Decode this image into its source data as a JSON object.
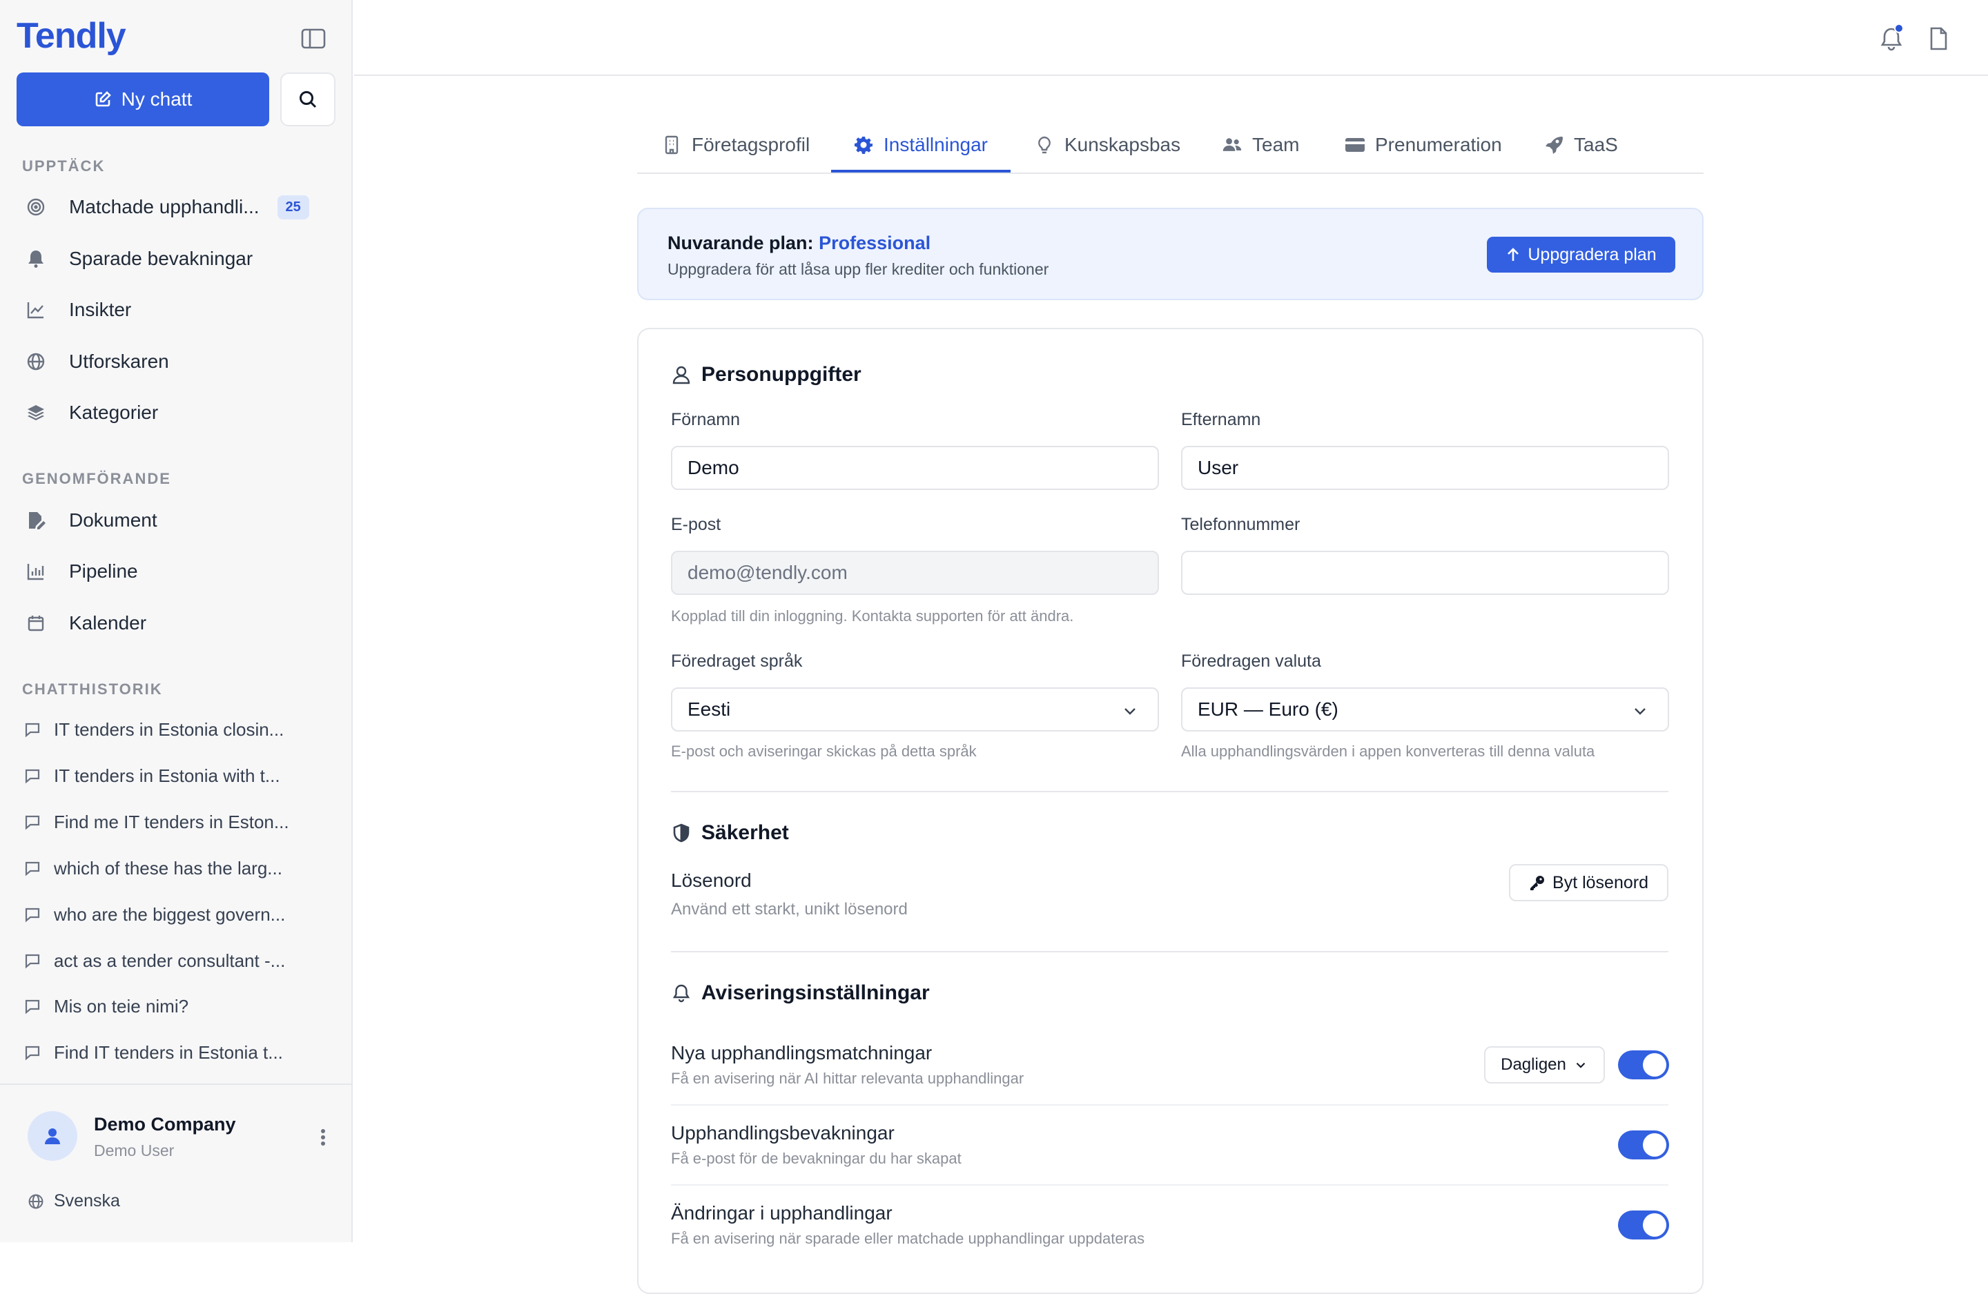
{
  "sidebar": {
    "brand": "Tendly",
    "new_chat_label": "Ny chatt",
    "sections": {
      "discover": "UPPTÄCK",
      "execution": "GENOMFÖRANDE",
      "history": "CHATTHISTORIK"
    },
    "discover_items": [
      {
        "label": "Matchade upphandli...",
        "icon": "target-icon",
        "badge": "25"
      },
      {
        "label": "Sparade bevakningar",
        "icon": "bell-icon"
      },
      {
        "label": "Insikter",
        "icon": "line-chart-icon"
      },
      {
        "label": "Utforskaren",
        "icon": "globe-icon"
      },
      {
        "label": "Kategorier",
        "icon": "layers-icon"
      }
    ],
    "execution_items": [
      {
        "label": "Dokument",
        "icon": "file-edit-icon"
      },
      {
        "label": "Pipeline",
        "icon": "bar-chart-icon"
      },
      {
        "label": "Kalender",
        "icon": "calendar-icon"
      }
    ],
    "chat_history": [
      "IT tenders in Estonia closin...",
      "IT tenders in Estonia with t...",
      "Find me IT tenders in Eston...",
      "which of these has the larg...",
      "who are the biggest govern...",
      "act as a tender consultant -...",
      "Mis on teie nimi?",
      "Find IT tenders in Estonia t..."
    ],
    "user": {
      "company": "Demo Company",
      "name": "Demo User"
    },
    "language": "Svenska"
  },
  "tabs": [
    {
      "label": "Företagsprofil",
      "icon": "building-icon",
      "active": false
    },
    {
      "label": "Inställningar",
      "icon": "gear-icon",
      "active": true
    },
    {
      "label": "Kunskapsbas",
      "icon": "lightbulb-icon",
      "active": false
    },
    {
      "label": "Team",
      "icon": "users-icon",
      "active": false
    },
    {
      "label": "Prenumeration",
      "icon": "credit-card-icon",
      "active": false
    },
    {
      "label": "TaaS",
      "icon": "rocket-icon",
      "active": false
    }
  ],
  "plan": {
    "prefix": "Nuvarande plan:",
    "name": "Professional",
    "subtitle": "Uppgradera för att låsa upp fler krediter och funktioner",
    "upgrade_label": "Uppgradera plan"
  },
  "personal": {
    "heading": "Personuppgifter",
    "first_name_label": "Förnamn",
    "first_name_value": "Demo",
    "last_name_label": "Efternamn",
    "last_name_value": "User",
    "email_label": "E-post",
    "email_placeholder": "demo@tendly.com",
    "email_hint": "Kopplad till din inloggning. Kontakta supporten för att ändra.",
    "phone_label": "Telefonnummer",
    "phone_value": "",
    "language_label": "Föredraget språk",
    "language_value": "Eesti",
    "language_hint": "E-post och aviseringar skickas på detta språk",
    "currency_label": "Föredragen valuta",
    "currency_value": "EUR — Euro (€)",
    "currency_hint": "Alla upphandlingsvärden i appen konverteras till denna valuta"
  },
  "security": {
    "heading": "Säkerhet",
    "password_label": "Lösenord",
    "password_hint": "Använd ett starkt, unikt lösenord",
    "change_password_label": "Byt lösenord"
  },
  "notifications": {
    "heading": "Aviseringsinställningar",
    "frequency_value": "Dagligen",
    "items": [
      {
        "title": "Nya upphandlingsmatchningar",
        "subtitle": "Få en avisering när AI hittar relevanta upphandlingar",
        "enabled": true
      },
      {
        "title": "Upphandlingsbevakningar",
        "subtitle": "Få e-post för de bevakningar du har skapat",
        "enabled": true
      },
      {
        "title": "Ändringar i upphandlingar",
        "subtitle": "Få en avisering när sparade eller matchade upphandlingar uppdateras",
        "enabled": true
      }
    ]
  },
  "colors": {
    "accent": "#3360e0",
    "brand": "#2b55d6",
    "sidebar_bg": "#f7f7f8",
    "plan_bg": "#eef3fd"
  }
}
